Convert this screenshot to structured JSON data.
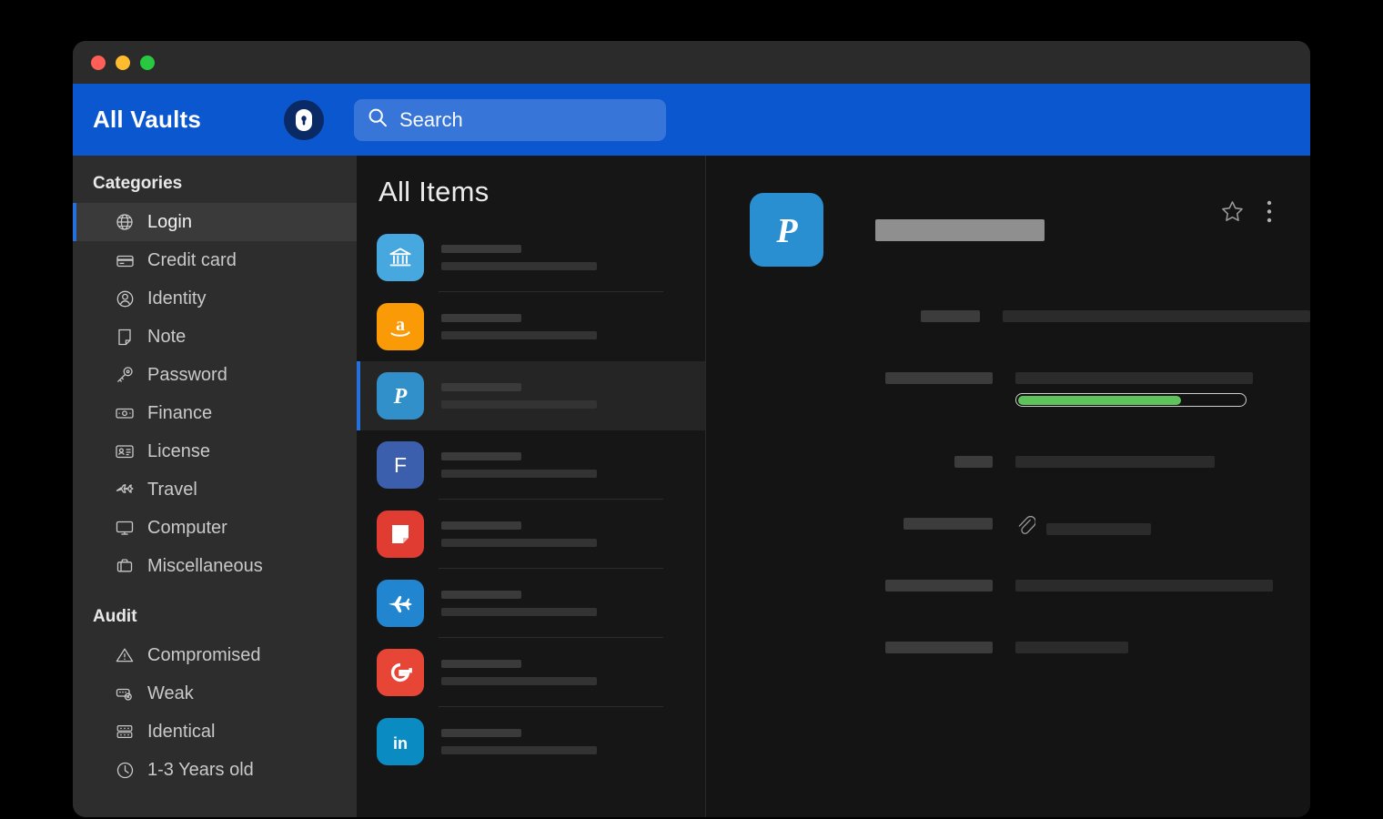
{
  "window": {
    "traffic_lights": [
      "close",
      "minimize",
      "zoom"
    ]
  },
  "toolbar": {
    "vault_title": "All Vaults",
    "brand_icon": "1password-lock-icon",
    "search_placeholder": "Search",
    "search_value": "",
    "search_icon": "search-icon",
    "accent_color": "#0b57d0"
  },
  "sidebar": {
    "categories_heading": "Categories",
    "audit_heading": "Audit",
    "categories": [
      {
        "label": "Login",
        "icon": "globe-icon",
        "active": true
      },
      {
        "label": "Credit card",
        "icon": "credit-card-icon",
        "active": false
      },
      {
        "label": "Identity",
        "icon": "person-circle-icon",
        "active": false
      },
      {
        "label": "Note",
        "icon": "note-icon",
        "active": false
      },
      {
        "label": "Password",
        "icon": "key-icon",
        "active": false
      },
      {
        "label": "Finance",
        "icon": "banknote-icon",
        "active": false
      },
      {
        "label": "License",
        "icon": "id-card-icon",
        "active": false
      },
      {
        "label": "Travel",
        "icon": "airplane-icon",
        "active": false
      },
      {
        "label": "Computer",
        "icon": "monitor-icon",
        "active": false
      },
      {
        "label": "Miscellaneous",
        "icon": "briefcase-icon",
        "active": false
      }
    ],
    "audit": [
      {
        "label": "Compromised",
        "icon": "warning-triangle-icon"
      },
      {
        "label": "Weak",
        "icon": "weak-password-icon"
      },
      {
        "label": "Identical",
        "icon": "identical-icon"
      },
      {
        "label": "1-3 Years old",
        "icon": "clock-icon"
      }
    ],
    "active_accent": "#2471de"
  },
  "item_list": {
    "title": "All Items",
    "items": [
      {
        "icon": "bank-icon",
        "bg": "#47a8e0",
        "redacted": true,
        "selected": false
      },
      {
        "icon": "amazon-icon",
        "bg": "#f99a06",
        "redacted": true,
        "selected": false
      },
      {
        "icon": "paypal-icon",
        "bg": "#3190ca",
        "redacted": true,
        "selected": true
      },
      {
        "icon": "facebook-icon",
        "bg": "#3c5fad",
        "redacted": true,
        "selected": false
      },
      {
        "icon": "note-app-icon",
        "bg": "#e03c31",
        "redacted": true,
        "selected": false
      },
      {
        "icon": "airplane-app-icon",
        "bg": "#2185d0",
        "redacted": true,
        "selected": false
      },
      {
        "icon": "google-icon",
        "bg": "#e74536",
        "redacted": true,
        "selected": false
      },
      {
        "icon": "linkedin-icon",
        "bg": "#0a8bc2",
        "redacted": true,
        "selected": false
      }
    ]
  },
  "detail": {
    "app_icon": "paypal-icon",
    "app_icon_bg": "#2a8fd0",
    "title_redacted": true,
    "favorite_icon": "star-outline-icon",
    "more_icon": "more-vertical-icon",
    "attachment_icon": "paperclip-icon",
    "password_strength_percent": 72,
    "strength_color": "#5ec35a",
    "fields": [
      {
        "label_width": 65,
        "value_width": 338,
        "type": "text"
      },
      {
        "label_width": 118,
        "value_width": 261,
        "type": "password"
      },
      {
        "label_width": 42,
        "value_width": 219,
        "type": "text"
      },
      {
        "label_width": 98,
        "value_width": 115,
        "type": "attachment"
      },
      {
        "label_width": 118,
        "value_width": 283,
        "type": "text"
      },
      {
        "label_width": 118,
        "value_width": 124,
        "type": "text"
      }
    ]
  }
}
